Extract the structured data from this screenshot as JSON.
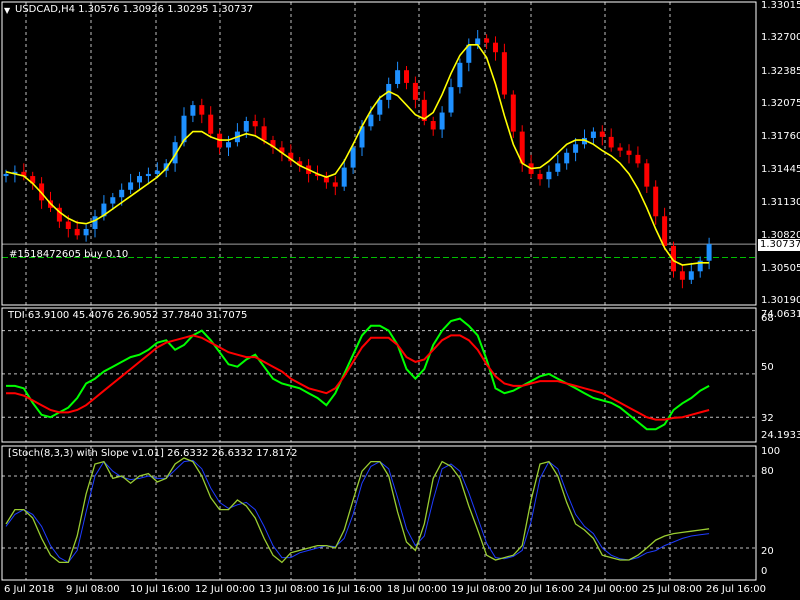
{
  "header": {
    "menu_glyph": "▼",
    "text": "USDCAD,H4  1.30576 1.30926 1.30295 1.30737"
  },
  "order_label": "#1518472605 buy 0.10",
  "colors": {
    "bull": "#1E90FF",
    "bear": "#FF0000",
    "ma": "#FFFF00",
    "tdi_green": "#00FF00",
    "tdi_red": "#FF0000",
    "stoch_main": "#9ACD32",
    "stoch_signal": "#1E3CFF",
    "grid": "#FFFFFF",
    "bid_line": "#A0A0A0",
    "order_line": "#00C000",
    "frame": "#FFFFFF",
    "price_badge_bg": "#FFFFFF",
    "price_badge_fg": "#000000"
  },
  "price_axis": {
    "labels": [
      "1.33015",
      "1.32700",
      "1.32385",
      "1.32075",
      "1.31760",
      "1.31445",
      "1.31130",
      "1.30820",
      "1.30505",
      "1.30190"
    ],
    "current": "1.30737"
  },
  "tdi": {
    "label": "TDI 63.9100 45.4076 26.9052 37.7840 31.7075",
    "axis_labels": [
      "74.0631",
      "68",
      "50",
      "32",
      "24.1933"
    ]
  },
  "stoch": {
    "label": "[Stoch(8,3,3) with Slope v1.01] 26.6332 26.6332 17.8172",
    "axis_labels": [
      "100",
      "80",
      "20",
      "0"
    ]
  },
  "time_axis": {
    "labels": [
      "6 Jul 2018",
      "9 Jul 08:00",
      "10 Jul 16:00",
      "12 Jul 00:00",
      "13 Jul 08:00",
      "16 Jul 16:00",
      "18 Jul 00:00",
      "19 Jul 08:00",
      "20 Jul 16:00",
      "24 Jul 00:00",
      "25 Jul 08:00",
      "26 Jul 16:00"
    ]
  },
  "chart_data": [
    {
      "type": "candlestick",
      "title": "USDCAD,H4",
      "ylim": [
        1.3019,
        1.33015
      ],
      "x": [
        "6 Jul 2018",
        "9 Jul 08:00",
        "10 Jul 16:00",
        "12 Jul 00:00",
        "13 Jul 08:00",
        "16 Jul 16:00",
        "18 Jul 00:00",
        "19 Jul 08:00",
        "20 Jul 16:00",
        "24 Jul 00:00",
        "25 Jul 08:00",
        "26 Jul 16:00"
      ],
      "closes": [
        1.314,
        1.3142,
        1.3138,
        1.3131,
        1.3115,
        1.3108,
        1.3095,
        1.3088,
        1.3082,
        1.3088,
        1.31,
        1.3112,
        1.3118,
        1.3125,
        1.3132,
        1.3138,
        1.314,
        1.3143,
        1.315,
        1.317,
        1.3195,
        1.3205,
        1.3196,
        1.3178,
        1.3165,
        1.317,
        1.318,
        1.319,
        1.3185,
        1.3172,
        1.3165,
        1.316,
        1.3152,
        1.3148,
        1.314,
        1.3138,
        1.3132,
        1.3128,
        1.3146,
        1.3165,
        1.3185,
        1.3196,
        1.321,
        1.3225,
        1.3238,
        1.3226,
        1.321,
        1.319,
        1.3182,
        1.3198,
        1.3222,
        1.3245,
        1.3262,
        1.3268,
        1.3264,
        1.3255,
        1.3215,
        1.318,
        1.315,
        1.314,
        1.3135,
        1.3142,
        1.315,
        1.316,
        1.3168,
        1.3174,
        1.318,
        1.3175,
        1.3165,
        1.3162,
        1.3158,
        1.315,
        1.3128,
        1.31,
        1.3072,
        1.3048,
        1.304,
        1.3048,
        1.3058,
        1.30737
      ],
      "series": [
        {
          "name": "moving average",
          "values": [
            1.3142,
            1.314,
            1.3138,
            1.3131,
            1.3122,
            1.3112,
            1.3104,
            1.3098,
            1.3094,
            1.3093,
            1.3096,
            1.3101,
            1.3107,
            1.3113,
            1.3119,
            1.3125,
            1.3131,
            1.3137,
            1.3145,
            1.3158,
            1.3172,
            1.318,
            1.318,
            1.3175,
            1.3172,
            1.3172,
            1.3175,
            1.3178,
            1.3176,
            1.3171,
            1.3166,
            1.316,
            1.3154,
            1.3148,
            1.3144,
            1.314,
            1.3137,
            1.314,
            1.3152,
            1.3168,
            1.3185,
            1.32,
            1.3212,
            1.3218,
            1.3214,
            1.3205,
            1.3196,
            1.3192,
            1.3198,
            1.3215,
            1.3235,
            1.3252,
            1.3262,
            1.3262,
            1.325,
            1.3225,
            1.3195,
            1.3168,
            1.315,
            1.3145,
            1.3146,
            1.3152,
            1.316,
            1.3168,
            1.3172,
            1.3172,
            1.3168,
            1.3162,
            1.3157,
            1.315,
            1.314,
            1.3126,
            1.3108,
            1.3088,
            1.307,
            1.3058,
            1.3054,
            1.3055,
            1.3056,
            1.3056
          ]
        }
      ],
      "annotations": [
        "#1518472605 buy 0.10"
      ]
    },
    {
      "type": "line",
      "title": "TDI 63.9100 45.4076 26.9052 37.7840 31.7075",
      "ylim": [
        24.1933,
        74.0631
      ],
      "series": [
        {
          "name": "",
          "values": [
            45,
            45,
            44,
            38,
            33,
            32,
            34,
            36,
            40,
            46,
            48,
            51,
            53,
            55,
            57,
            58,
            60,
            63,
            64,
            60,
            62,
            66,
            68,
            64,
            59,
            54,
            53,
            56,
            58,
            53,
            48,
            46,
            45,
            44,
            42,
            40,
            37,
            42,
            50,
            58,
            66,
            70,
            70,
            68,
            62,
            52,
            48,
            52,
            62,
            68,
            72,
            73,
            70,
            66,
            56,
            44,
            42,
            43,
            45,
            47,
            49,
            50,
            48,
            46,
            44,
            42,
            40,
            39,
            38,
            36,
            33,
            30,
            27,
            27,
            29,
            35,
            37.8,
            40,
            43,
            45
          ]
        },
        {
          "name": "",
          "values": [
            42,
            42,
            41,
            39,
            37,
            35,
            34,
            34,
            35,
            37,
            40,
            43,
            46,
            49,
            52,
            55,
            58,
            61,
            63,
            64,
            65,
            66,
            65,
            63,
            61,
            59,
            58,
            57,
            57,
            55,
            53,
            51,
            48,
            46,
            44,
            43,
            42,
            44,
            49,
            55,
            61,
            65,
            65,
            65,
            62,
            57,
            55,
            56,
            60,
            64,
            66,
            66,
            64,
            60,
            54,
            49,
            46,
            45,
            45,
            46,
            47,
            47,
            47,
            46,
            45,
            44,
            43,
            42,
            40,
            38,
            36,
            34,
            32,
            31,
            31,
            31.7,
            32,
            33,
            34,
            35
          ]
        }
      ]
    },
    {
      "type": "line",
      "title": "[Stoch(8,3,3) with Slope v1.01] 26.6332 26.6332 17.8172",
      "ylim": [
        0,
        100
      ],
      "series": [
        {
          "name": "",
          "values": [
            40,
            52,
            52,
            45,
            28,
            14,
            8,
            8,
            30,
            65,
            90,
            92,
            78,
            80,
            74,
            80,
            82,
            75,
            78,
            90,
            95,
            92,
            80,
            62,
            52,
            52,
            60,
            55,
            45,
            28,
            14,
            8,
            16,
            18,
            20,
            22,
            22,
            20,
            35,
            60,
            84,
            92,
            92,
            80,
            50,
            25,
            18,
            40,
            78,
            92,
            88,
            78,
            55,
            35,
            14,
            10,
            12,
            14,
            22,
            60,
            90,
            92,
            80,
            58,
            40,
            35,
            28,
            14,
            12,
            10,
            10,
            14,
            20,
            26.6,
            30,
            32,
            33,
            34,
            35,
            36
          ]
        },
        {
          "name": "",
          "values": [
            38,
            48,
            52,
            48,
            38,
            22,
            12,
            8,
            18,
            50,
            80,
            92,
            84,
            79,
            77,
            78,
            80,
            78,
            78,
            85,
            92,
            93,
            86,
            70,
            58,
            53,
            56,
            58,
            52,
            38,
            22,
            12,
            12,
            16,
            18,
            20,
            22,
            21,
            28,
            48,
            74,
            88,
            92,
            86,
            62,
            36,
            22,
            30,
            60,
            86,
            90,
            84,
            66,
            45,
            24,
            12,
            11,
            13,
            18,
            42,
            78,
            92,
            86,
            66,
            48,
            38,
            32,
            20,
            14,
            11,
            10,
            12,
            16,
            17.8,
            22,
            25,
            28,
            30,
            31,
            32
          ]
        }
      ]
    }
  ]
}
